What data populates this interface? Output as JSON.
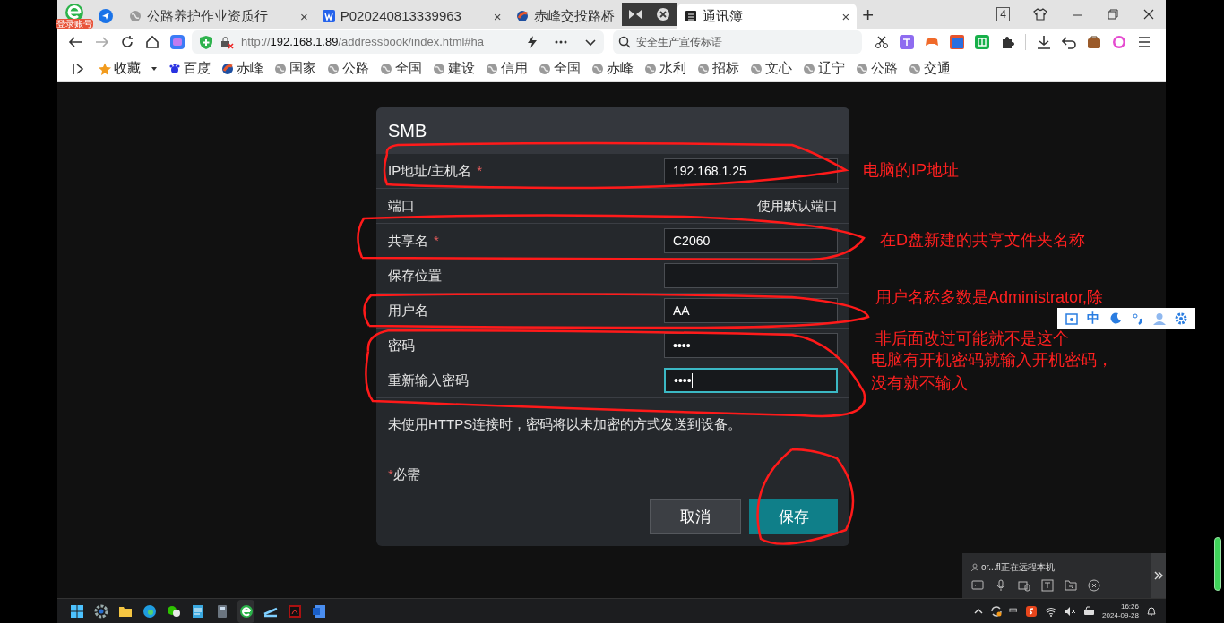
{
  "app_badge": "登录账号",
  "tabs": [
    {
      "kind": "pinned",
      "selected": false
    },
    {
      "kind": "page",
      "title": "公路养护作业资质行",
      "close": "×",
      "selected": false
    },
    {
      "kind": "page",
      "title": "P020240813339963",
      "close": "×",
      "selected": false
    },
    {
      "kind": "page",
      "title": "赤峰交投路桥",
      "selected": false
    },
    {
      "kind": "page",
      "title": "通讯簿",
      "close": "×",
      "selected": true
    }
  ],
  "new_tab": "+",
  "tab_count": "4",
  "url": {
    "scheme": "http://",
    "host": "192.168.1.89",
    "path": "/addressbook/index.html#ha"
  },
  "search": {
    "placeholder": "安全生产宣传标语"
  },
  "bookmarks": [
    {
      "kind": "folder",
      "label": "收藏"
    },
    {
      "kind": "site",
      "label": "百度"
    },
    {
      "kind": "site",
      "label": "赤峰"
    },
    {
      "kind": "site",
      "label": "国家"
    },
    {
      "kind": "site",
      "label": "公路"
    },
    {
      "kind": "site",
      "label": "全国"
    },
    {
      "kind": "site",
      "label": "建设"
    },
    {
      "kind": "site",
      "label": "信用"
    },
    {
      "kind": "site",
      "label": "全国"
    },
    {
      "kind": "site",
      "label": "赤峰"
    },
    {
      "kind": "site",
      "label": "水利"
    },
    {
      "kind": "site",
      "label": "招标"
    },
    {
      "kind": "site",
      "label": "文心"
    },
    {
      "kind": "site",
      "label": "辽宁"
    },
    {
      "kind": "site",
      "label": "公路"
    },
    {
      "kind": "site",
      "label": "交通"
    }
  ],
  "dialog": {
    "title": "SMB",
    "fields": [
      {
        "kind": "input",
        "label": "IP地址/主机名",
        "required": true,
        "value": "192.168.1.25",
        "focused": false
      },
      {
        "kind": "text",
        "label": "端口",
        "value": "使用默认端口"
      },
      {
        "kind": "input",
        "label": "共享名",
        "required": true,
        "value": "C2060",
        "focused": false
      },
      {
        "kind": "input",
        "label": "保存位置",
        "required": false,
        "focused": false
      },
      {
        "kind": "input",
        "label": "用户名",
        "required": false,
        "value": "AA",
        "focused": false
      },
      {
        "kind": "input",
        "label": "密码",
        "required": false,
        "value": "••••",
        "focused": false
      },
      {
        "kind": "input",
        "label": "重新输入密码",
        "required": false,
        "value": "••••",
        "focused": true
      }
    ],
    "note": "未使用HTTPS连接时，密码将以未加密的方式发送到设备。",
    "required_note": {
      "mark": "*",
      "text": "必需"
    },
    "buttons": [
      {
        "kind": "secondary",
        "label": "取消"
      },
      {
        "kind": "primary",
        "label": "保存"
      }
    ]
  },
  "annotations": [
    {
      "lines": [
        "电脑的IP地址"
      ]
    },
    {
      "lines": [
        "在D盘新建的共享文件夹名称"
      ]
    },
    {
      "lines": [
        "用户名称多数是Administrator,除",
        "非后面改过可能就不是这个"
      ]
    },
    {
      "lines": [
        "电脑有开机密码就输入开机密码，",
        "没有就不输入"
      ]
    }
  ],
  "ime_bar": {
    "mode": "中"
  },
  "remote_panel": {
    "status": "or...fl正在远程本机"
  },
  "tray": {
    "ime": "中",
    "time": "16:26",
    "date": "2024-09-28"
  }
}
